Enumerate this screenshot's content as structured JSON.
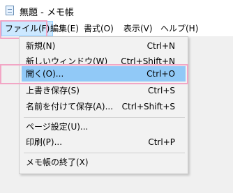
{
  "window": {
    "title": "無題 - メモ帳",
    "icon": "notepad-icon"
  },
  "menubar": {
    "items": [
      {
        "label": "ファイル(F)"
      },
      {
        "label": "編集(E)"
      },
      {
        "label": "書式(O)"
      },
      {
        "label": "表示(V)"
      },
      {
        "label": "ヘルプ(H)"
      }
    ]
  },
  "file_menu": {
    "items": [
      {
        "label": "新規(N)",
        "shortcut": "Ctrl+N"
      },
      {
        "label": "新しいウィンドウ(W)",
        "shortcut": "Ctrl+Shift+N"
      },
      {
        "label": "開く(O)...",
        "shortcut": "Ctrl+O"
      },
      {
        "label": "上書き保存(S)",
        "shortcut": "Ctrl+S"
      },
      {
        "label": "名前を付けて保存(A)...",
        "shortcut": "Ctrl+Shift+S"
      },
      {
        "label": "ページ設定(U)...",
        "shortcut": ""
      },
      {
        "label": "印刷(P)...",
        "shortcut": "Ctrl+P"
      },
      {
        "label": "メモ帳の終了(X)",
        "shortcut": ""
      }
    ]
  },
  "colors": {
    "highlight_item": "#91c9f7",
    "active_menu": "#cce8ff",
    "annotation_outline": "#f2a6c5"
  }
}
